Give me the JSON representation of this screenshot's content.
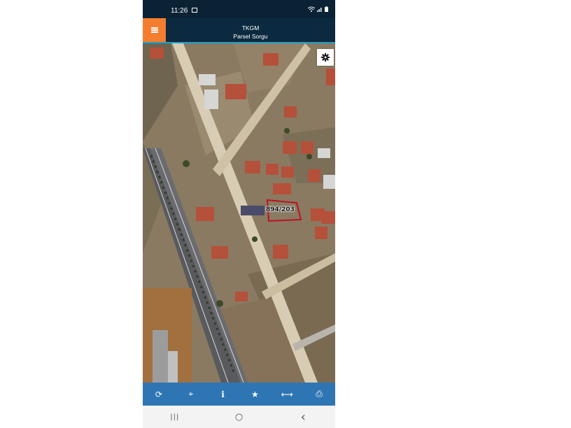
{
  "status_bar": {
    "time": "11:26"
  },
  "header": {
    "app_name": "TKGM",
    "subtitle": "Parsel Sorgu"
  },
  "map": {
    "parcel_label": "894/203",
    "parcel_color": "#c01020"
  },
  "toolbar": {
    "items": [
      {
        "icon": "refresh-icon",
        "glyph": "⟳"
      },
      {
        "icon": "locate-icon",
        "glyph": "⌖"
      },
      {
        "icon": "info-icon",
        "glyph": "i"
      },
      {
        "icon": "star-icon",
        "glyph": "★"
      },
      {
        "icon": "measure-icon",
        "glyph": "⟷"
      },
      {
        "icon": "print-icon",
        "glyph": "⎙"
      }
    ]
  },
  "nav_bar": {
    "items": [
      {
        "icon": "recents-icon",
        "glyph": "|||"
      },
      {
        "icon": "home-icon",
        "glyph": "○"
      },
      {
        "icon": "back-icon",
        "glyph": "‹"
      }
    ]
  },
  "colors": {
    "header": "#0b2a40",
    "menu_button": "#f47d30",
    "toolbar": "#2e76b3",
    "accent_line": "#1fa0c8"
  }
}
